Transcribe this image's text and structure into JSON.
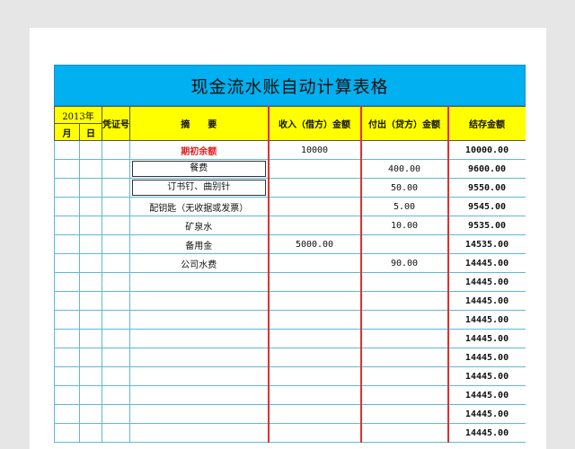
{
  "title": "现金流水账自动计算表格",
  "header": {
    "year": "2013年",
    "month": "月",
    "day": "日",
    "voucher": "凭证号",
    "summary": "摘　　要",
    "income": "收入（借方）金额",
    "expense": "付出（贷方）金额",
    "balance": "结存金额"
  },
  "rows": [
    {
      "summary": "期初余额",
      "income": "10000",
      "expense": "",
      "balance": "10000.00"
    },
    {
      "summary": "餐费",
      "income": "",
      "expense": "400.00",
      "balance": "9600.00"
    },
    {
      "summary": "订书钉、曲别针",
      "income": "",
      "expense": "50.00",
      "balance": "9550.00"
    },
    {
      "summary": "配钥匙（无收据或发票）",
      "income": "",
      "expense": "5.00",
      "balance": "9545.00"
    },
    {
      "summary": "矿泉水",
      "income": "",
      "expense": "10.00",
      "balance": "9535.00"
    },
    {
      "summary": "备用金",
      "income": "5000.00",
      "expense": "",
      "balance": "14535.00"
    },
    {
      "summary": "公司水费",
      "income": "",
      "expense": "90.00",
      "balance": "14445.00"
    },
    {
      "summary": "",
      "income": "",
      "expense": "",
      "balance": "14445.00"
    },
    {
      "summary": "",
      "income": "",
      "expense": "",
      "balance": "14445.00"
    },
    {
      "summary": "",
      "income": "",
      "expense": "",
      "balance": "14445.00"
    },
    {
      "summary": "",
      "income": "",
      "expense": "",
      "balance": "14445.00"
    },
    {
      "summary": "",
      "income": "",
      "expense": "",
      "balance": "14445.00"
    },
    {
      "summary": "",
      "income": "",
      "expense": "",
      "balance": "14445.00"
    },
    {
      "summary": "",
      "income": "",
      "expense": "",
      "balance": "14445.00"
    },
    {
      "summary": "",
      "income": "",
      "expense": "",
      "balance": "14445.00"
    },
    {
      "summary": "",
      "income": "",
      "expense": "",
      "balance": "14445.00"
    }
  ],
  "colors": {
    "title_bg": "#00b0f0",
    "header_bg": "#ffff00",
    "grid_line": "#5fb7dc",
    "emphasis_border": "#e03030",
    "opening_text": "#e02020",
    "page_bg": "#e6e6e6"
  }
}
